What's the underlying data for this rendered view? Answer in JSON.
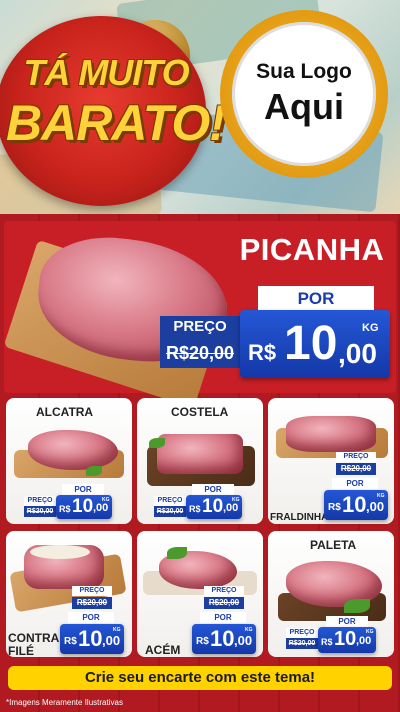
{
  "header": {
    "badge_line1": "TÁ MUITO",
    "badge_line2": "BARATO!",
    "logo_line1": "Sua Logo",
    "logo_line2": "Aqui"
  },
  "featured": {
    "name": "PICANHA",
    "por_label": "POR",
    "preco_label": "PREÇO",
    "old_price": "R$20,00",
    "currency": "R$",
    "price_int": "10",
    "price_dec": ",00",
    "unit": "KG"
  },
  "products": [
    {
      "name": "ALCATRA",
      "preco_label": "PREÇO",
      "old_price": "R$20,00",
      "por_label": "POR",
      "currency": "R$",
      "price_int": "10",
      "price_dec": ",00",
      "unit": "KG"
    },
    {
      "name": "COSTELA",
      "preco_label": "PREÇO",
      "old_price": "R$20,00",
      "por_label": "POR",
      "currency": "R$",
      "price_int": "10",
      "price_dec": ",00",
      "unit": "KG"
    },
    {
      "name": "FRALDINHA",
      "preco_label": "PREÇO",
      "old_price": "R$20,00",
      "por_label": "POR",
      "currency": "R$",
      "price_int": "10",
      "price_dec": ",00",
      "unit": "KG"
    },
    {
      "name_line1": "CONTRA",
      "name_line2": "FILÉ",
      "preco_label": "PREÇO",
      "old_price": "R$20,00",
      "por_label": "POR",
      "currency": "R$",
      "price_int": "10",
      "price_dec": ",00",
      "unit": "KG"
    },
    {
      "name": "ACÉM",
      "preco_label": "PREÇO",
      "old_price": "R$20,00",
      "por_label": "POR",
      "currency": "R$",
      "price_int": "10",
      "price_dec": ",00",
      "unit": "KG"
    },
    {
      "name": "PALETA",
      "preco_label": "PREÇO",
      "old_price": "R$20,00",
      "por_label": "POR",
      "currency": "R$",
      "price_int": "10",
      "price_dec": ",00",
      "unit": "KG"
    }
  ],
  "footer": {
    "cta": "Crie seu encarte com este tema!",
    "disclaimer": "*Imagens Meramente Ilustrativas"
  },
  "colors": {
    "brand_red": "#c81f26",
    "price_blue": "#1f4fc8",
    "badge_yellow": "#ffd23a",
    "cta_yellow": "#ffd200"
  }
}
